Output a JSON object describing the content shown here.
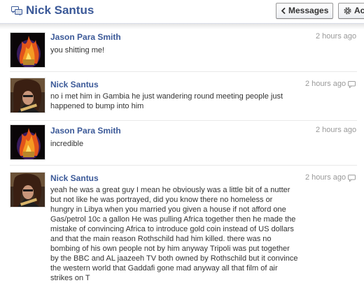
{
  "header": {
    "title": "Nick Santus",
    "messages_button": "Messages",
    "actions_button": "Ac"
  },
  "messages": [
    {
      "sender": "Jason Para Smith",
      "time": "2 hours ago",
      "text": "you shitting me!"
    },
    {
      "sender": "Nick Santus",
      "time": "2 hours ago",
      "text": "no i met him in Gambia he just wandering round meeting people just\nhappened to bump into him"
    },
    {
      "sender": "Jason Para Smith",
      "time": "2 hours ago",
      "text": "incredible"
    },
    {
      "sender": "Nick Santus",
      "time": "2 hours ago",
      "text": "yeah he was a great guy I mean he obviously was a little bit of a nutter\nbut not like he was portrayed, did you know there no homeless or\nhungry in Libya when you married you given a house if not afford one\nGas/petrol 10c a gallon He was pulling Africa together then he made the\nmistake of convincing Africa to introduce gold coin instead of US dollars\nand that the main reason Rothschild had him killed. there was no\nbombing of his own people not by him anyway Tripoli was put together\nby the BBC and AL jaazeeh TV both owned by Rothschild but it convince\nthe western world that Gaddafi gone mad anyway all that film of air\nstrikes on T"
    }
  ],
  "colors": {
    "link": "#3b5998",
    "timestamp": "#999999",
    "text": "#333333"
  }
}
